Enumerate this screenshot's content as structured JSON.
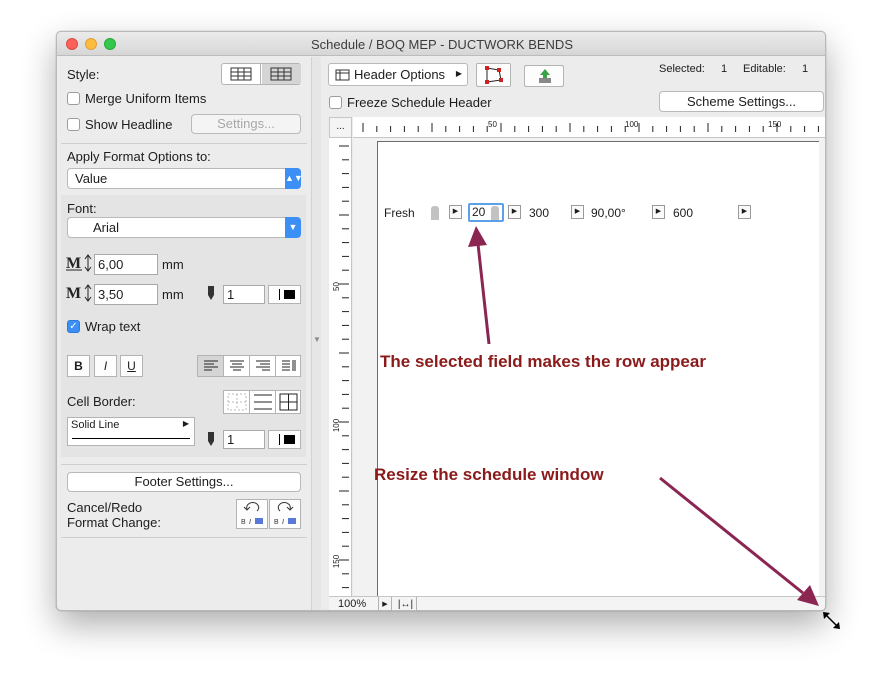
{
  "window": {
    "title": "Schedule / BOQ MEP - DUCTWORK BENDS"
  },
  "left_panel": {
    "style_label": "Style:",
    "merge_uniform": {
      "label": "Merge Uniform Items",
      "checked": false
    },
    "show_headline": {
      "label": "Show Headline",
      "checked": false
    },
    "settings_button": "Settings...",
    "apply_format_label": "Apply Format Options to:",
    "apply_format_value": "Value",
    "font_label": "Font:",
    "font_value": "Arial",
    "size1_value": "6,00",
    "size1_unit": "mm",
    "size2_value": "3,50",
    "size2_unit": "mm",
    "pen_value": "1",
    "wrap_text": {
      "label": "Wrap text",
      "checked": true
    },
    "bold_label": "B",
    "italic_label": "I",
    "underline_label": "U",
    "cell_border_label": "Cell Border:",
    "line_type": "Solid Line",
    "border_pen_value": "1",
    "footer_button": "Footer Settings...",
    "cancel_redo_line1": "Cancel/Redo",
    "cancel_redo_line2": "Format Change:"
  },
  "toolbar": {
    "header_options": "Header Options",
    "freeze_header": {
      "label": "Freeze Schedule Header",
      "checked": false
    },
    "selected_label": "Selected:",
    "selected_value": "1",
    "editable_label": "Editable:",
    "editable_value": "1",
    "scheme_settings": "Scheme Settings..."
  },
  "ruler": {
    "corner": "...",
    "h_ticks": [
      "50",
      "100",
      "150"
    ],
    "v_ticks": [
      "50",
      "100",
      "150"
    ]
  },
  "schedule_row": {
    "cells": [
      "Fresh",
      "20",
      "300",
      "90,00°",
      "600"
    ]
  },
  "status": {
    "zoom": "100%"
  },
  "annotations": {
    "selected_field": "The selected field makes the row appear",
    "resize": "Resize the schedule window"
  },
  "colors": {
    "annotation": "#8b1a1a",
    "arrow": "#8b2552",
    "accent": "#3b8ff5"
  }
}
